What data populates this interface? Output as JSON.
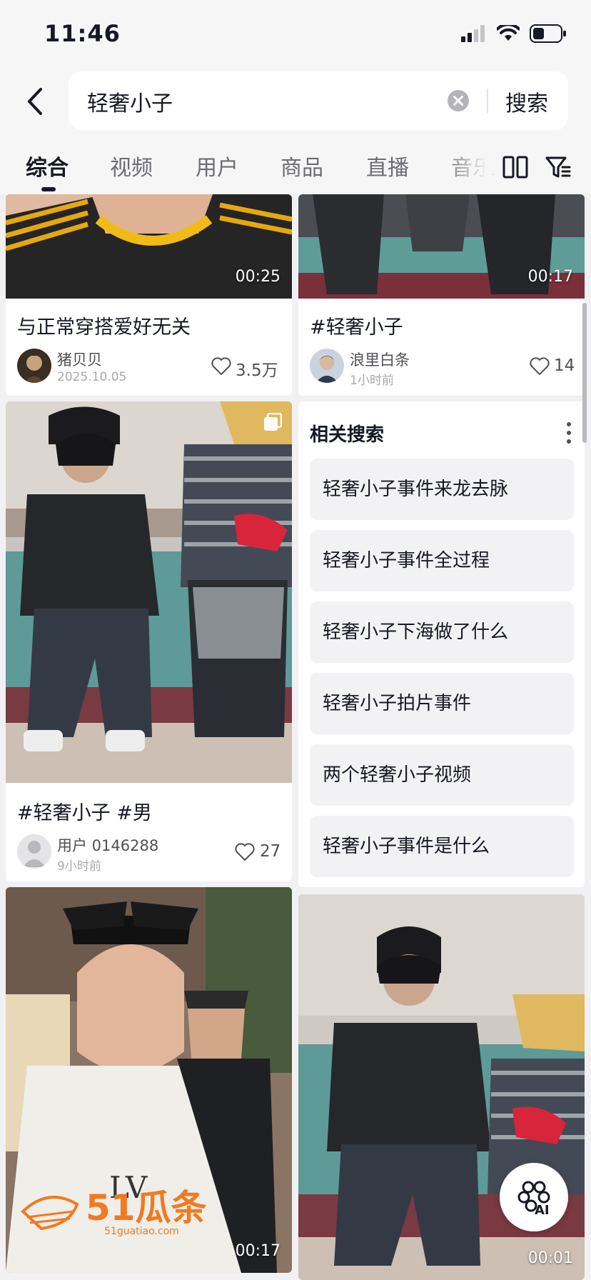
{
  "status_bar": {
    "time": "11:46",
    "signal_icon": "cellular-signal-icon",
    "wifi_icon": "wifi-icon",
    "battery_icon": "battery-icon"
  },
  "header": {
    "back_icon": "chevron-left-icon",
    "search_query": "轻奢小子",
    "clear_icon": "clear-circle-icon",
    "search_button": "搜索"
  },
  "tabs": {
    "items": [
      "综合",
      "视频",
      "用户",
      "商品",
      "直播",
      "音乐"
    ],
    "active": "综合",
    "layout_icon": "double-column-icon",
    "filter_icon": "filter-icon"
  },
  "cards": [
    {
      "title": "与正常穿搭爱好无关",
      "author": "猪贝贝",
      "time": "2025.10.05",
      "likes": "3.5万",
      "duration": "00:25"
    },
    {
      "title": "#轻奢小子",
      "author": "浪里白条",
      "time": "1小时前",
      "likes": "14",
      "duration": "00:17"
    },
    {
      "title": "#轻奢小子 #男",
      "author": "用户 0146288",
      "time": "9小时前",
      "likes": "27",
      "badge_icon": "multi-image-icon"
    },
    {
      "duration": "00:17"
    },
    {
      "duration": "00:01"
    }
  ],
  "related": {
    "title": "相关搜索",
    "more_icon": "more-vertical-icon",
    "items": [
      "轻奢小子事件来龙去脉",
      "轻奢小子事件全过程",
      "轻奢小子下海做了什么",
      "轻奢小子拍片事件",
      "两个轻奢小子视频",
      "轻奢小子事件是什么"
    ]
  },
  "ai_button": {
    "label": "AI",
    "icon": "ai-assistant-icon"
  },
  "watermark": {
    "text": "51瓜条",
    "sub": "51guatiao.com"
  },
  "colors": {
    "accent": "#161823",
    "background": "#f1f1f3",
    "watermark": "#f07a22"
  }
}
